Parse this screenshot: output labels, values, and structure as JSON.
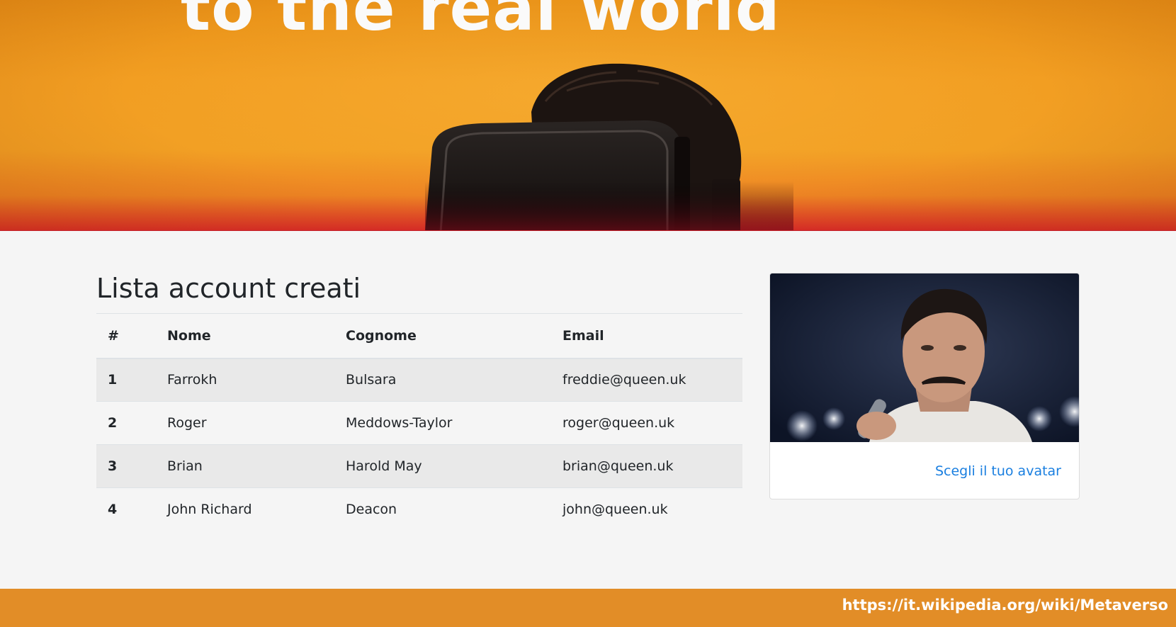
{
  "hero": {
    "title": "to the real world"
  },
  "accounts": {
    "title": "Lista account creati",
    "columns": [
      "#",
      "Nome",
      "Cognome",
      "Email"
    ],
    "rows": [
      {
        "num": "1",
        "nome": "Farrokh",
        "cognome": "Bulsara",
        "email": "freddie@queen.uk"
      },
      {
        "num": "2",
        "nome": "Roger",
        "cognome": "Meddows-Taylor",
        "email": "roger@queen.uk"
      },
      {
        "num": "3",
        "nome": "Brian",
        "cognome": "Harold May",
        "email": "brian@queen.uk"
      },
      {
        "num": "4",
        "nome": "John Richard",
        "cognome": "Deacon",
        "email": "john@queen.uk"
      }
    ]
  },
  "card": {
    "link_label": "Scegli il tuo avatar"
  },
  "footer": {
    "link_label": "https://it.wikipedia.org/wiki/Metaverso"
  },
  "colors": {
    "hero_orange": "#f29e22",
    "hero_red": "#dc2a2a",
    "footer_orange": "#e28d27",
    "link_blue": "#1a7fe0",
    "page_bg": "#f5f5f5"
  }
}
